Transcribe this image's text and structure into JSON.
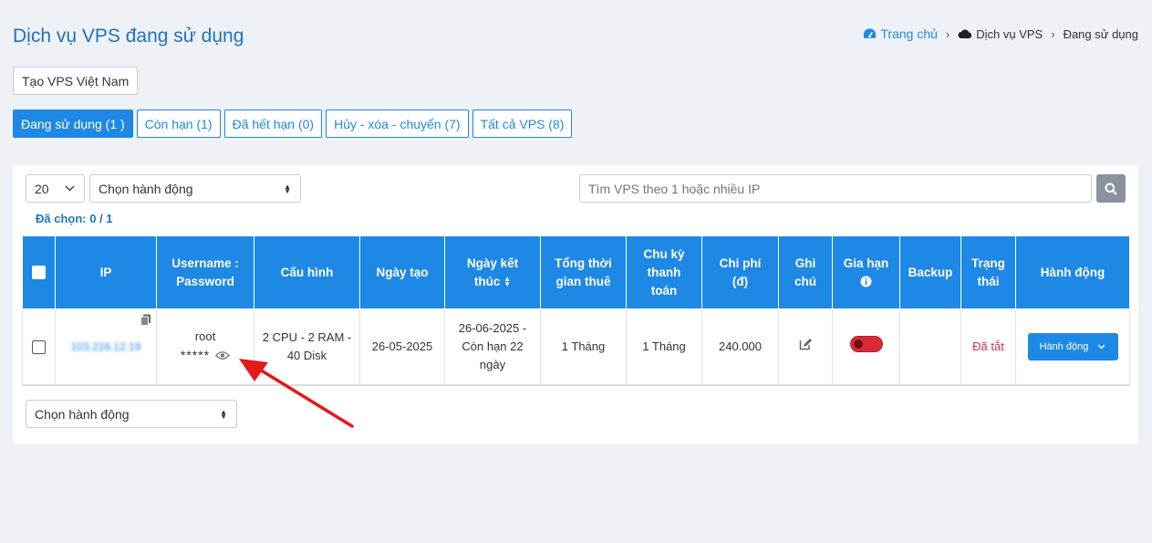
{
  "page": {
    "title": "Dịch vụ VPS đang sử dụng"
  },
  "breadcrumb": {
    "home": "Trang chủ",
    "middle": "Dịch vụ VPS",
    "current": "Đang sử dụng"
  },
  "create_button": "Tạo VPS Việt Nam",
  "tabs": [
    {
      "label": "Đang sử dụng (1 )"
    },
    {
      "label": "Còn hạn (1)"
    },
    {
      "label": "Đã hết hạn (0)"
    },
    {
      "label": "Hủy - xóa - chuyển (7)"
    },
    {
      "label": "Tất cả VPS (8)"
    }
  ],
  "toolbar": {
    "page_size": "20",
    "action_select": "Chọn hành động",
    "search_placeholder": "Tìm VPS theo 1 hoặc nhiều IP",
    "selected": "Đã chọn: 0 / 1"
  },
  "table": {
    "headers": {
      "ip": "IP",
      "userpass": [
        "Username :",
        "Password"
      ],
      "config": "Cấu hình",
      "created": "Ngày tạo",
      "end": [
        "Ngày kết",
        "thúc"
      ],
      "total": [
        "Tổng thời",
        "gian thuê"
      ],
      "cycle": [
        "Chu kỳ",
        "thanh",
        "toán"
      ],
      "cost": [
        "Chi phí",
        "(đ)"
      ],
      "note": [
        "Ghi",
        "chú"
      ],
      "renew": "Gia hạn",
      "backup": "Backup",
      "status": [
        "Trạng",
        "thái"
      ],
      "action": "Hành động"
    },
    "row": {
      "ip": "103.216.12.19",
      "username": "root",
      "password": "*****",
      "config": [
        "2 CPU - 2 RAM -",
        "40 Disk"
      ],
      "created": "26-05-2025",
      "end": [
        "26-06-2025 -",
        "Còn hạn 22",
        "ngày"
      ],
      "total": "1 Tháng",
      "cycle": "1 Tháng",
      "cost": "240.000",
      "status": "Đã tắt",
      "action": "Hành động"
    }
  },
  "bottom": {
    "action_select": "Chọn hành động"
  },
  "colors": {
    "primary": "#1e88e5",
    "title": "#1e73be",
    "danger": "#d72b3b",
    "arrow": "#e3191c"
  }
}
